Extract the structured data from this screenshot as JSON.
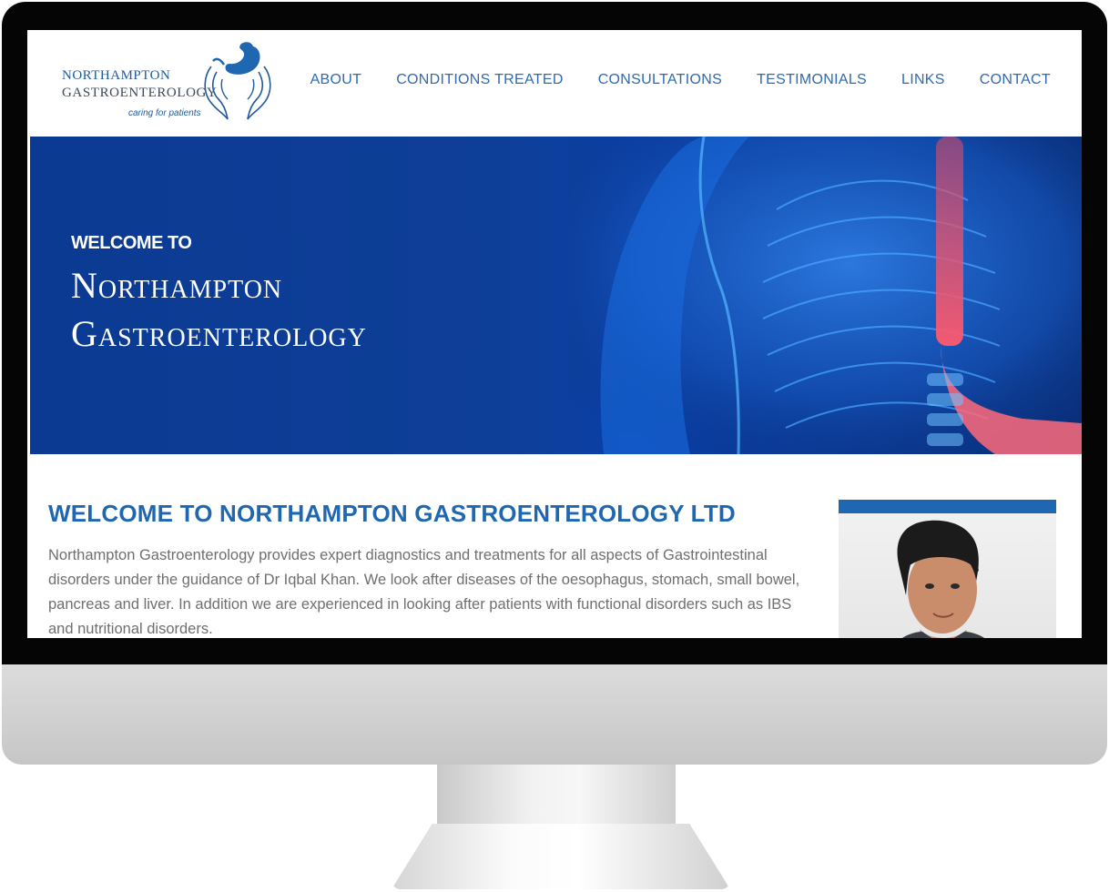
{
  "logo": {
    "line1": "NORTHAMPTON",
    "line2": "GASTROENTEROLOGY",
    "tagline": "caring for patients",
    "icon": "stomach-in-hands-icon"
  },
  "nav": {
    "items": [
      "ABOUT",
      "CONDITIONS TREATED",
      "CONSULTATIONS",
      "TESTIMONIALS",
      "LINKS",
      "CONTACT"
    ]
  },
  "hero": {
    "welcome": "WELCOME TO",
    "title_line1": "Northampton",
    "title_line2": "Gastroenterology"
  },
  "intro": {
    "title": "WELCOME TO NORTHAMPTON GASTROENTEROLOGY LTD",
    "text": "Northampton Gastroenterology provides expert diagnostics and treatments for all aspects of Gastrointestinal disorders under the guidance of Dr Iqbal Khan. We look after diseases of the oesophagus, stomach, small bowel, pancreas and liver. In addition we are experienced in looking after patients with functional disorders such as IBS and nutritional disorders."
  },
  "colors": {
    "brand_blue": "#1f67b1",
    "nav_blue": "#2f6ab0",
    "hero_blue": "#0b3a92",
    "body_text": "#6f6f6f"
  }
}
